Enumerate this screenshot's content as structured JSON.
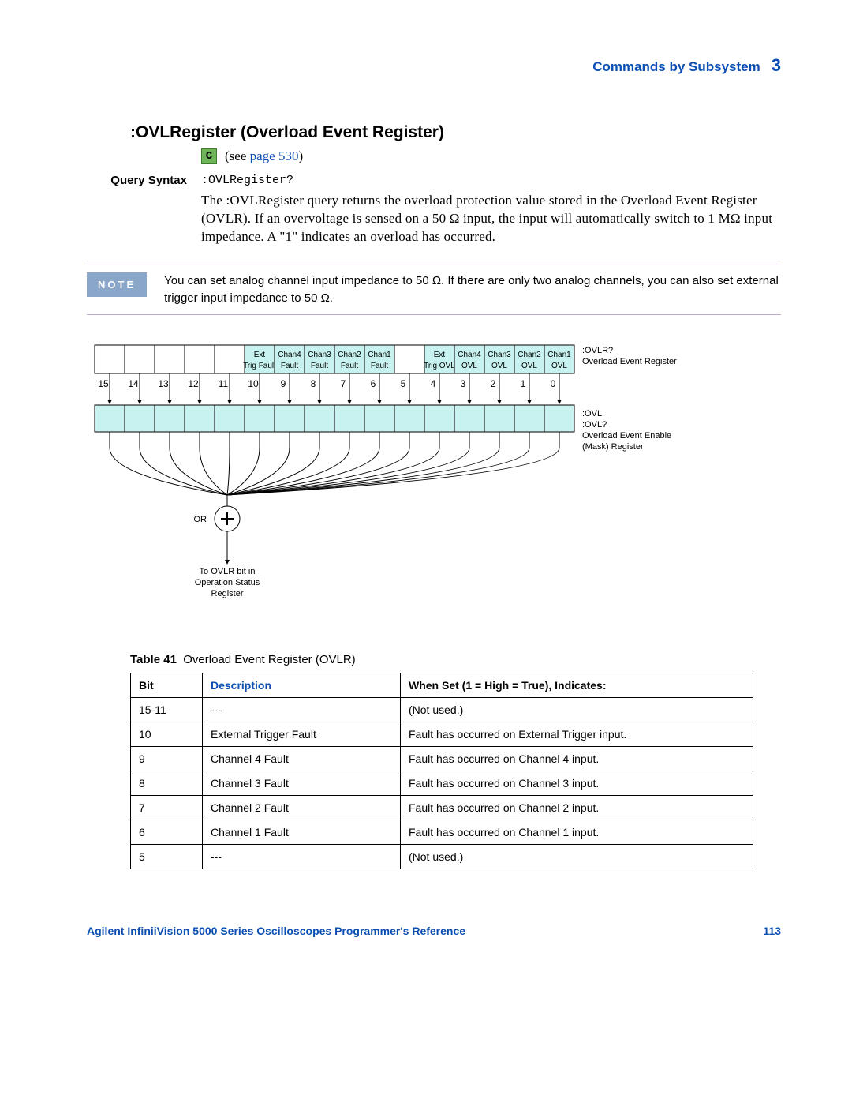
{
  "header": {
    "section": "Commands by Subsystem",
    "chapter": "3"
  },
  "title": ":OVLRegister (Overload Event Register)",
  "see": {
    "prefix": "(see ",
    "link": "page 530",
    "suffix": ")"
  },
  "query": {
    "label": "Query Syntax",
    "command": ":OVLRegister?",
    "paragraph": "The :OVLRegister query returns the overload protection value stored in the Overload Event Register (OVLR). If an overvoltage is sensed on a 50 Ω input, the input will automatically switch to 1 MΩ input impedance. A \"1\" indicates an overload has occurred."
  },
  "note": {
    "badge": "NOTE",
    "text": "You can set analog channel input impedance to 50 Ω. If there are only two analog channels, you can also set external trigger input impedance to 50 Ω."
  },
  "diagram": {
    "top_labels": [
      "",
      "",
      "",
      "",
      "",
      "Ext Trig Fault",
      "Chan4 Fault",
      "Chan3 Fault",
      "Chan2 Fault",
      "Chan1 Fault",
      "",
      "Ext Trig OVL",
      "Chan4 OVL",
      "Chan3 OVL",
      "Chan2 OVL",
      "Chan1 OVL"
    ],
    "bits": [
      "15",
      "14",
      "13",
      "12",
      "11",
      "10",
      "9",
      "8",
      "7",
      "6",
      "5",
      "4",
      "3",
      "2",
      "1",
      "0"
    ],
    "right_top": [
      ":OVLR?",
      "Overload Event Register"
    ],
    "right_bottom": [
      ":OVL",
      ":OVL?",
      "Overload Event Enable",
      "(Mask) Register"
    ],
    "or_label": "OR",
    "dest": [
      "To OVLR bit in",
      "Operation Status",
      "Register"
    ]
  },
  "table": {
    "caption_prefix": "Table 41",
    "caption": "Overload Event Register (OVLR)",
    "headers": [
      "Bit",
      "Description",
      "When Set (1 = High = True), Indicates:"
    ],
    "rows": [
      [
        "15-11",
        "---",
        "(Not used.)"
      ],
      [
        "10",
        "External Trigger Fault",
        "Fault has occurred on External Trigger input."
      ],
      [
        "9",
        "Channel 4 Fault",
        "Fault has occurred on Channel 4 input."
      ],
      [
        "8",
        "Channel 3 Fault",
        "Fault has occurred on Channel 3 input."
      ],
      [
        "7",
        "Channel 2 Fault",
        "Fault has occurred on Channel 2 input."
      ],
      [
        "6",
        "Channel 1 Fault",
        "Fault has occurred on Channel 1 input."
      ],
      [
        "5",
        "---",
        "(Not used.)"
      ]
    ]
  },
  "footer": {
    "book": "Agilent InfiniiVision 5000 Series Oscilloscopes Programmer's Reference",
    "page": "113"
  }
}
